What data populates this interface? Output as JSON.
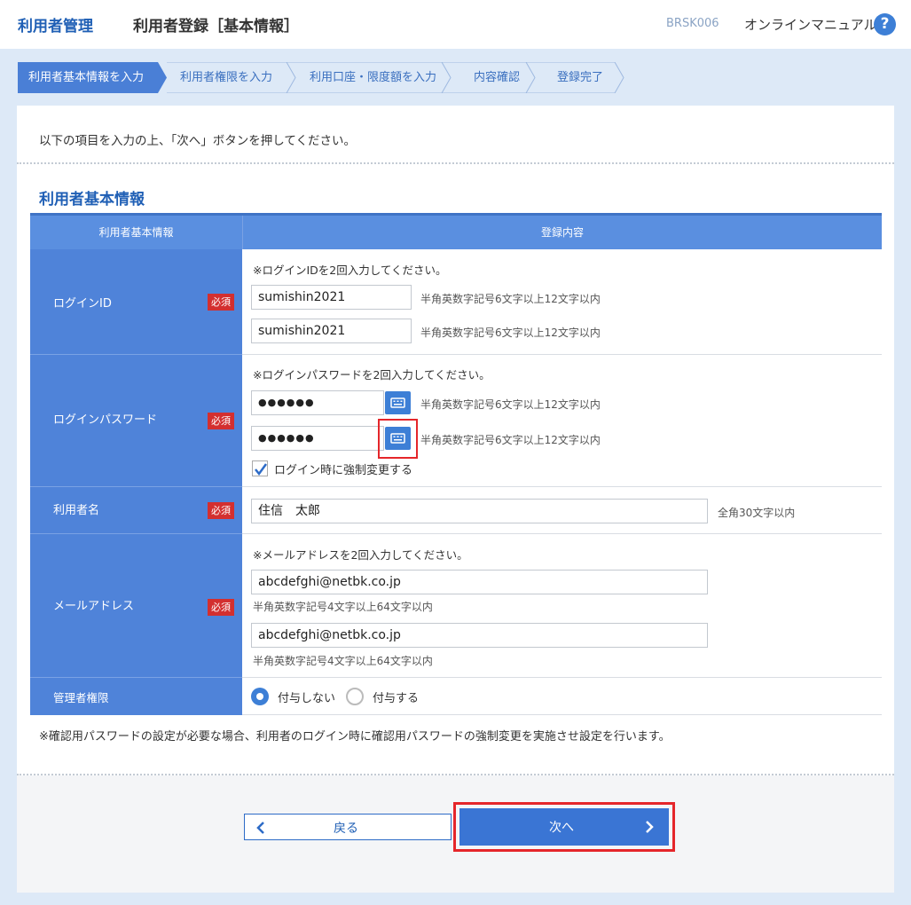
{
  "header": {
    "breadcrumb": "利用者管理",
    "page_title": "利用者登録［基本情報］",
    "screen_code": "BRSK006",
    "manual_link": "オンラインマニュアル",
    "help_glyph": "?"
  },
  "steps": [
    {
      "label": "利用者基本情報を入力",
      "active": true
    },
    {
      "label": "利用者権限を入力",
      "active": false
    },
    {
      "label": "利用口座・限度額を入力",
      "active": false
    },
    {
      "label": "内容確認",
      "active": false
    },
    {
      "label": "登録完了",
      "active": false
    }
  ],
  "intro": "以下の項目を入力の上、「次へ」ボタンを押してください。",
  "section_title": "利用者基本情報",
  "table": {
    "col_label": "利用者基本情報",
    "col_value": "登録内容",
    "required_badge": "必須"
  },
  "login_id": {
    "label": "ログインID",
    "note": "※ログインIDを2回入力してください。",
    "value1": "sumishin2021",
    "value2": "sumishin2021",
    "hint": "半角英数字記号6文字以上12文字以内"
  },
  "login_password": {
    "label": "ログインパスワード",
    "note": "※ログインパスワードを2回入力してください。",
    "value1": "●●●●●●",
    "value2": "●●●●●●",
    "hint": "半角英数字記号6文字以上12文字以内",
    "force_change_label": "ログイン時に強制変更する",
    "force_change_checked": true
  },
  "user_name": {
    "label": "利用者名",
    "value": "住信　太郎",
    "hint": "全角30文字以内"
  },
  "email": {
    "label": "メールアドレス",
    "note": "※メールアドレスを2回入力してください。",
    "value1": "abcdefghi@netbk.co.jp",
    "value2": "abcdefghi@netbk.co.jp",
    "hint": "半角英数字記号4文字以上64文字以内"
  },
  "admin_rights": {
    "label": "管理者権限",
    "option_no": "付与しない",
    "option_yes": "付与する",
    "selected": "付与しない"
  },
  "footnote": "※確認用パスワードの設定が必要な場合、利用者のログイン時に確認用パスワードの強制変更を実施させ設定を行います。",
  "buttons": {
    "back": "戻る",
    "next": "次へ"
  },
  "colors": {
    "brand_blue": "#1f5fb5",
    "header_blue": "#5a8fe0",
    "label_blue": "#4f83d9",
    "required_red": "#d32f2f",
    "highlight_red": "#e5262a"
  }
}
